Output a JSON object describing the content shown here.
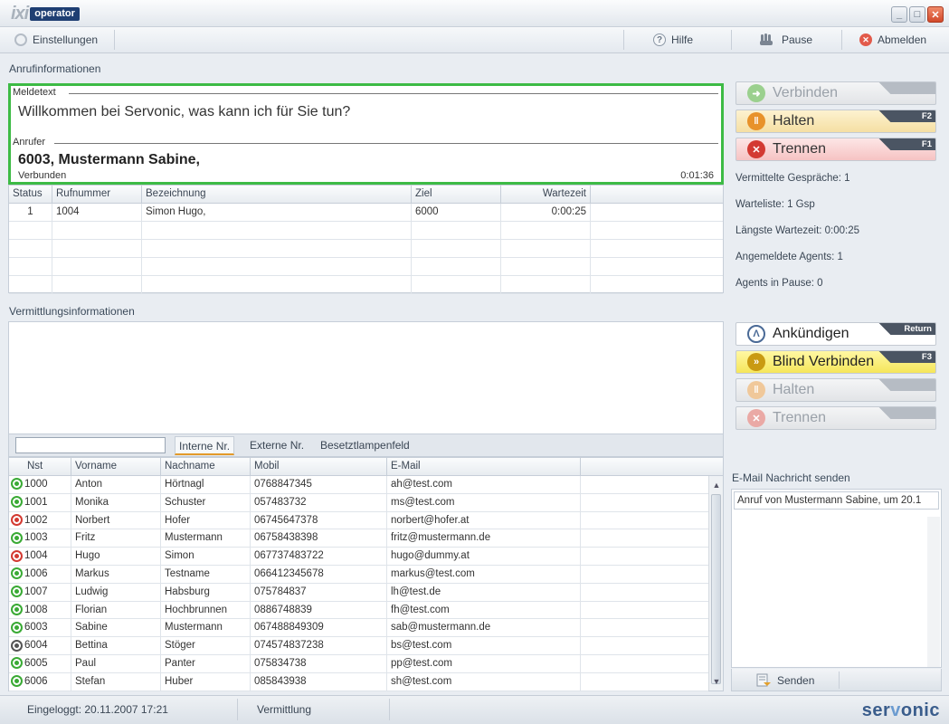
{
  "app": {
    "logo_mark": "ixi",
    "logo_text": "operator",
    "window_buttons": [
      "_",
      "□",
      "✕"
    ]
  },
  "toolbar": {
    "settings": "Einstellungen",
    "help": "Hilfe",
    "pause": "Pause",
    "logout": "Abmelden"
  },
  "call_info": {
    "section": "Anrufinformationen",
    "meldetext_label": "Meldetext",
    "meldetext": "Willkommen bei Servonic, was kann ich für Sie tun?",
    "anrufer_label": "Anrufer",
    "anrufer": "6003, Mustermann Sabine,",
    "state": "Verbunden",
    "duration": "0:01:36"
  },
  "queue": {
    "headers": [
      "Status",
      "Rufnummer",
      "Bezeichnung",
      "Ziel",
      "Wartezeit",
      ""
    ],
    "rows": [
      [
        "1",
        "1004",
        "Simon Hugo,",
        "6000",
        "0:00:25",
        ""
      ],
      [
        "",
        "",
        "",
        "",
        "",
        ""
      ],
      [
        "",
        "",
        "",
        "",
        "",
        ""
      ],
      [
        "",
        "",
        "",
        "",
        "",
        ""
      ],
      [
        "",
        "",
        "",
        "",
        "",
        ""
      ]
    ]
  },
  "actions_top": [
    {
      "label": "Verbinden",
      "key": "",
      "style": "disabled",
      "icon": "arrow-right-icon",
      "color": "#9bd08e"
    },
    {
      "label": "Halten",
      "key": "F2",
      "style": "halten",
      "icon": "pause-icon",
      "color": "#e8922a"
    },
    {
      "label": "Trennen",
      "key": "F1",
      "style": "trennen",
      "icon": "close-icon",
      "color": "#d33a32"
    }
  ],
  "stats": [
    "Vermittelte Gespräche: 1",
    "Warteliste: 1 Gsp",
    "Längste Wartezeit: 0:00:25",
    "Angemeldete Agents: 1",
    "Agents in Pause: 0"
  ],
  "transfer_info": {
    "section": "Vermittlungsinformationen"
  },
  "actions_bottom": [
    {
      "label": "Ankündigen",
      "key": "Return",
      "style": "announce",
      "icon": "announce-icon",
      "color": "#4a6a96"
    },
    {
      "label": "Blind Verbinden",
      "key": "F3",
      "style": "blind",
      "icon": "fast-forward-icon",
      "color": "#c99a12"
    },
    {
      "label": "Halten",
      "key": "",
      "style": "disabled",
      "icon": "pause-icon",
      "color": "#f0c89a"
    },
    {
      "label": "Trennen",
      "key": "",
      "style": "disabled",
      "icon": "close-icon",
      "color": "#eaa9a5"
    }
  ],
  "tabs": {
    "search_value": "",
    "items": [
      "Interne Nr.",
      "Externe Nr.",
      "Besetztlampenfeld"
    ]
  },
  "directory": {
    "headers": [
      "Nst",
      "Vorname",
      "Nachname",
      "Mobil",
      "E-Mail",
      ""
    ],
    "rows": [
      {
        "status": "green",
        "nst": "1000",
        "vorname": "Anton",
        "nachname": "Hörtnagl",
        "mobil": "0768847345",
        "email": "ah@test.com"
      },
      {
        "status": "green",
        "nst": "1001",
        "vorname": "Monika",
        "nachname": "Schuster",
        "mobil": "057483732",
        "email": "ms@test.com"
      },
      {
        "status": "red",
        "nst": "1002",
        "vorname": "Norbert",
        "nachname": "Hofer",
        "mobil": "06745647378",
        "email": "norbert@hofer.at"
      },
      {
        "status": "green",
        "nst": "1003",
        "vorname": "Fritz",
        "nachname": "Mustermann",
        "mobil": "06758438398",
        "email": "fritz@mustermann.de"
      },
      {
        "status": "red",
        "nst": "1004",
        "vorname": "Hugo",
        "nachname": "Simon",
        "mobil": "067737483722",
        "email": "hugo@dummy.at"
      },
      {
        "status": "green",
        "nst": "1006",
        "vorname": "Markus",
        "nachname": "Testname",
        "mobil": "066412345678",
        "email": "markus@test.com"
      },
      {
        "status": "green",
        "nst": "1007",
        "vorname": "Ludwig",
        "nachname": "Habsburg",
        "mobil": "075784837",
        "email": "lh@test.de"
      },
      {
        "status": "green",
        "nst": "1008",
        "vorname": "Florian",
        "nachname": "Hochbrunnen",
        "mobil": "0886748839",
        "email": "fh@test.com"
      },
      {
        "status": "green",
        "nst": "6003",
        "vorname": "Sabine",
        "nachname": "Mustermann",
        "mobil": "067488849309",
        "email": "sab@mustermann.de"
      },
      {
        "status": "grey",
        "nst": "6004",
        "vorname": "Bettina",
        "nachname": "Stöger",
        "mobil": "074574837238",
        "email": "bs@test.com"
      },
      {
        "status": "green",
        "nst": "6005",
        "vorname": "Paul",
        "nachname": "Panter",
        "mobil": "075834738",
        "email": "pp@test.com"
      },
      {
        "status": "green",
        "nst": "6006",
        "vorname": "Stefan",
        "nachname": "Huber",
        "mobil": "085843938",
        "email": "sh@test.com"
      }
    ]
  },
  "email": {
    "section": "E-Mail Nachricht senden",
    "subject": "Anruf von Mustermann Sabine,  um 20.1",
    "send": "Senden"
  },
  "statusbar": {
    "login": "Eingeloggt: 20.11.2007 17:21",
    "mode": "Vermittlung",
    "brand_a": "ser",
    "brand_b": "v",
    "brand_c": "onic"
  }
}
